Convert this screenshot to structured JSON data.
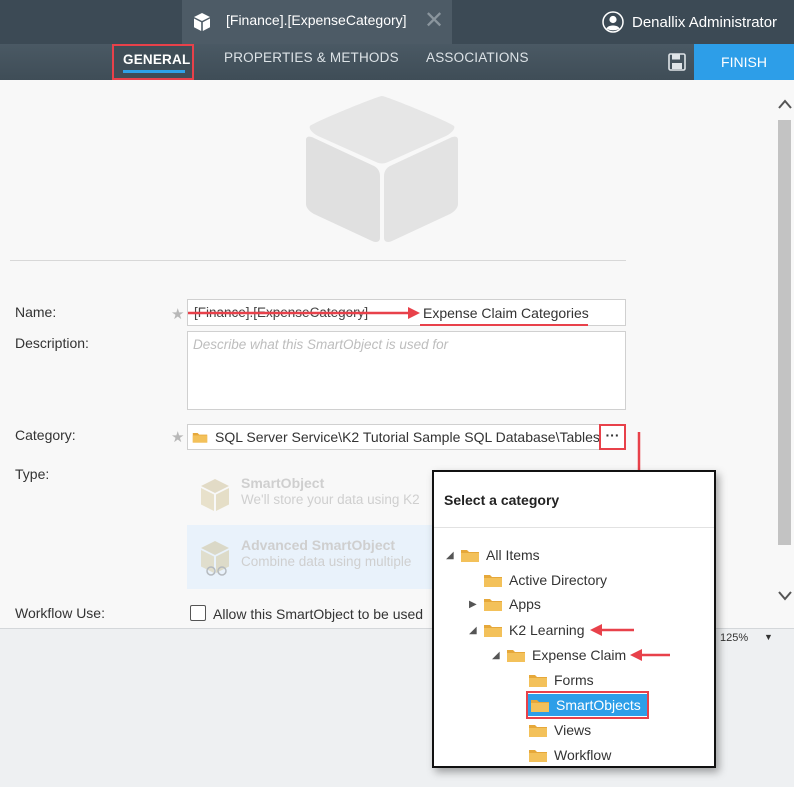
{
  "topbar": {
    "tab_title": "[Finance].[ExpenseCategory]",
    "close_glyph": "✕",
    "user_name": "Denallix Administrator"
  },
  "nav": {
    "general": "GENERAL",
    "properties": "PROPERTIES & METHODS",
    "associations": "ASSOCIATIONS",
    "finish": "FINISH"
  },
  "form": {
    "name_label": "Name:",
    "name_old_value": "[Finance].[ExpenseCategory]",
    "name_new_value": "Expense Claim Categories",
    "description_label": "Description:",
    "description_placeholder": "Describe what this SmartObject is used for",
    "category_label": "Category:",
    "category_value": "SQL Server Service\\K2 Tutorial Sample SQL Database\\Tables",
    "category_more": "···",
    "type_label": "Type:",
    "type_options": [
      {
        "title": "SmartObject",
        "desc": "We'll store your data using K2"
      },
      {
        "title": "Advanced SmartObject",
        "desc": "Combine data using multiple"
      }
    ],
    "workflow_label": "Workflow Use:",
    "workflow_checkbox_label": "Allow this SmartObject to be used"
  },
  "status": {
    "zoom": "125%"
  },
  "popup": {
    "title": "Select a category",
    "tree": [
      {
        "label": "All Items"
      },
      {
        "label": "Active Directory"
      },
      {
        "label": "Apps"
      },
      {
        "label": "K2 Learning"
      },
      {
        "label": "Expense Claim"
      },
      {
        "label": "Forms"
      },
      {
        "label": "SmartObjects"
      },
      {
        "label": "Views"
      },
      {
        "label": "Workflow"
      }
    ]
  },
  "colors": {
    "topbar": "#3c4a55",
    "accent_blue": "#2d9ee8",
    "annotation_red": "#e8414a",
    "folder": "#f0b849"
  },
  "icons": [
    "smartobject-cube-icon",
    "close-icon",
    "user-avatar-icon",
    "save-icon",
    "folder-icon",
    "expand-triangle-icon",
    "collapse-triangle-icon",
    "chevron-up-icon",
    "chevron-down-icon"
  ]
}
